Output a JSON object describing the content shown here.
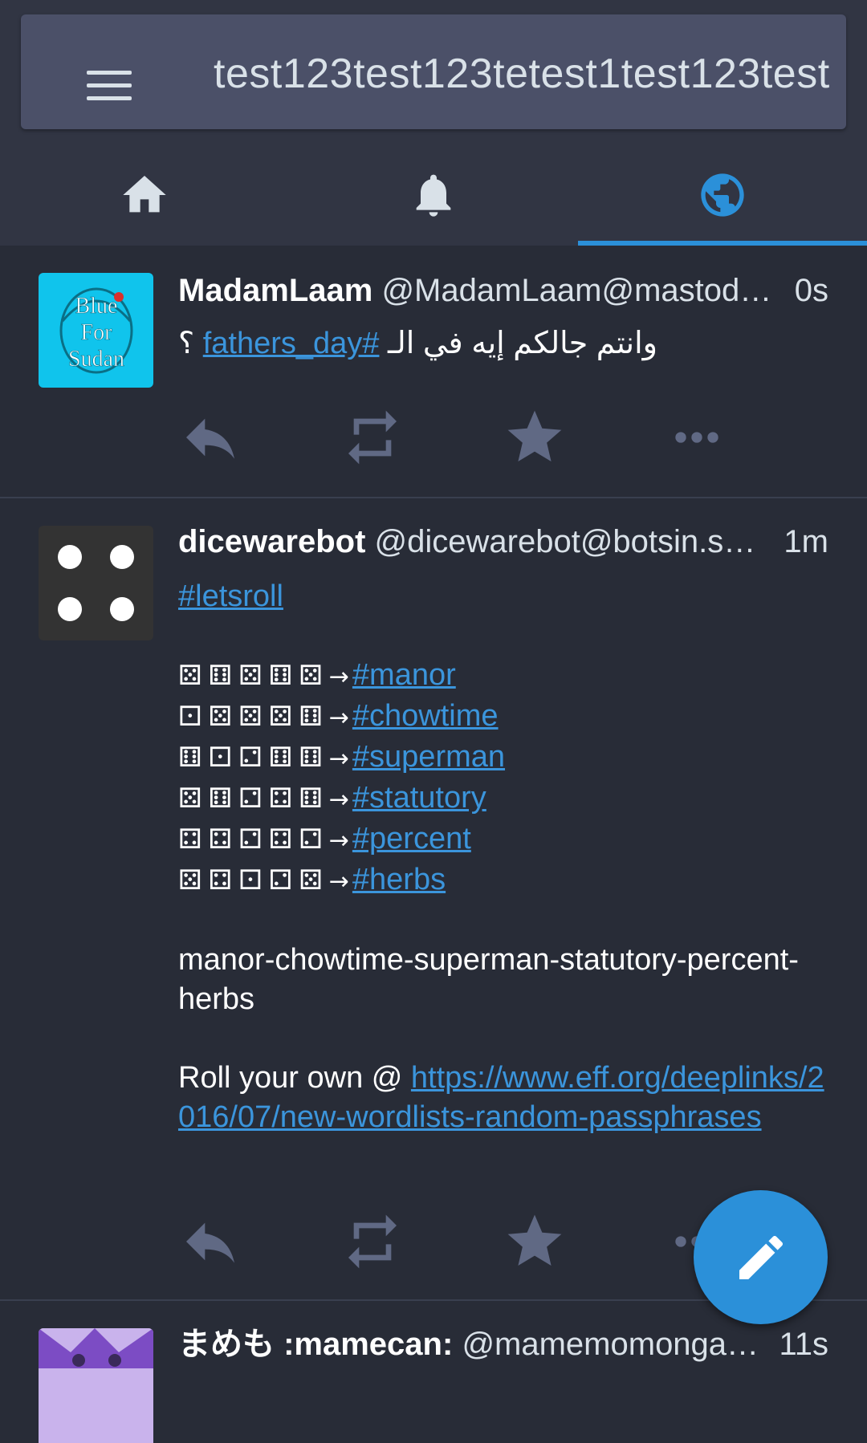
{
  "header": {
    "instance_title": "test123test123tetest1test123test"
  },
  "tabs": [
    {
      "name": "home",
      "icon": "home-icon"
    },
    {
      "name": "notifications",
      "icon": "bell-icon"
    },
    {
      "name": "federated",
      "icon": "globe-icon",
      "active": true
    }
  ],
  "statuses": [
    {
      "display_name": "MadamLaam",
      "acct": "@MadamLaam@mastod…",
      "time": "0s",
      "avatar_text": [
        "Blue",
        "For",
        "Sudan"
      ],
      "content": {
        "text": "وانتم جالكم إيه في الـ",
        "hashtag": "fathers_day#",
        "suffix": "؟"
      }
    },
    {
      "display_name": "dicewarebot",
      "acct": "@dicewarebot@botsin.s…",
      "time": "1m",
      "content": {
        "tag_line": "#letsroll",
        "rolls": [
          {
            "dice": "⚄⚅⚄⚅⚄",
            "tag": "#manor"
          },
          {
            "dice": "⚀⚄⚄⚄⚅",
            "tag": "#chowtime"
          },
          {
            "dice": "⚅⚀⚁⚅⚅",
            "tag": "#superman"
          },
          {
            "dice": "⚄⚅⚁⚃⚅",
            "tag": "#statutory"
          },
          {
            "dice": "⚃⚃⚁⚃⚁",
            "tag": "#percent"
          },
          {
            "dice": "⚄⚃⚀⚁⚄",
            "tag": "#herbs"
          }
        ],
        "arrow": "→",
        "passphrase": "manor-chowtime-superman-statutory-percent-herbs",
        "roll_prefix": "Roll your own @ ",
        "link": "https://www.eff.org/deeplinks/2016/07/new-wordlists-random-passphrases"
      }
    },
    {
      "display_name": "まめも :mamecan:",
      "acct": "@mamemomonga…",
      "time": "11s"
    }
  ],
  "colors": {
    "background": "#282c37",
    "header": "#313543",
    "search_bar": "#4b5068",
    "accent": "#2b90d9",
    "link": "#3b95dc",
    "action_icon": "#606984"
  }
}
